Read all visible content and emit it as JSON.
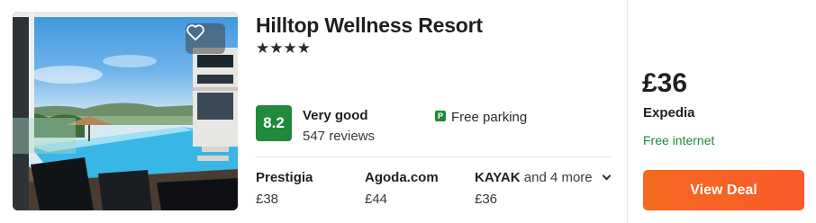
{
  "hotel": {
    "name": "Hilltop Wellness Resort",
    "stars": "★★★★",
    "photo_alt": "hotel-photo"
  },
  "rating": {
    "score": "8.2",
    "label": "Very good",
    "reviews": "547 reviews"
  },
  "amenities": {
    "parking_icon": "P",
    "parking": "Free parking"
  },
  "offers": [
    {
      "provider": "Prestigia",
      "price": "£38"
    },
    {
      "provider": "Agoda.com",
      "price": "£44"
    },
    {
      "provider": "KAYAK",
      "more": "and 4 more",
      "price": "£36"
    }
  ],
  "best_deal": {
    "price": "£36",
    "provider": "Expedia",
    "amenity": "Free internet",
    "button": "View Deal"
  },
  "colors": {
    "score_green": "#1f8a3a",
    "deal_orange": "#f46a1f"
  },
  "icons": {
    "favorite": "heart-icon",
    "parking": "parking-icon",
    "expand": "chevron-down-icon"
  }
}
